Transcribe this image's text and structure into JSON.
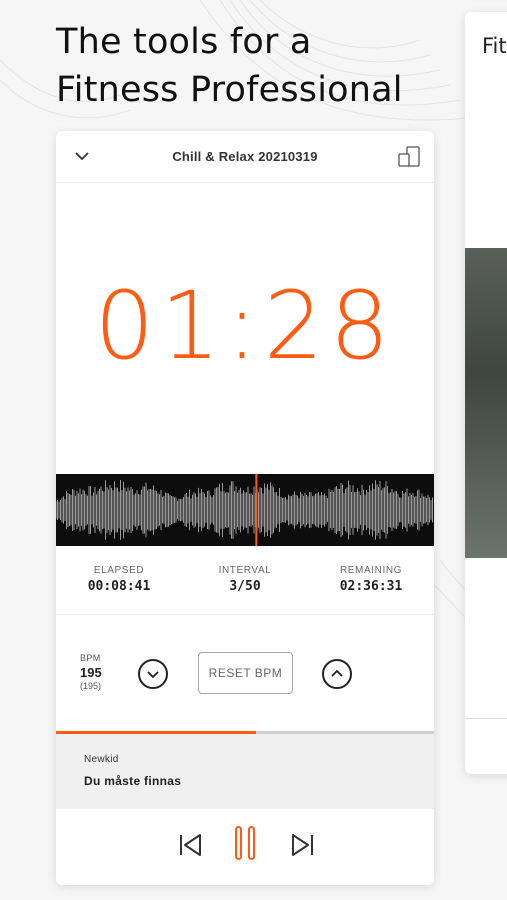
{
  "headline": {
    "line1": "The tools for a",
    "line2": "Fitness Professional"
  },
  "player": {
    "track_title": "Chill & Relax 20210319",
    "timer": "01:28",
    "stats": {
      "elapsed_label": "ELAPSED",
      "elapsed_value": "00:08:41",
      "interval_label": "INTERVAL",
      "interval_value": "3/50",
      "remaining_label": "REMAINING",
      "remaining_value": "02:36:31"
    },
    "bpm": {
      "label": "BPM",
      "value": "195",
      "original": "(195)"
    },
    "reset_label": "RESET BPM",
    "progress_fraction": 0.53,
    "waveform_position_fraction": 0.53,
    "now_playing": {
      "artist": "Newkid",
      "song": "Du måste finnas"
    }
  },
  "icons": {
    "collapse": "chevron-down-icon",
    "device": "devices-icon",
    "bpm_down": "chevron-down-circle-icon",
    "bpm_up": "chevron-up-circle-icon",
    "prev": "skip-previous-icon",
    "pause": "pause-icon",
    "next": "skip-next-icon"
  },
  "colors": {
    "accent": "#ff5b12",
    "waveform": "#9a9a9a",
    "waveform_bg": "#0d0d0d"
  },
  "side_card": {
    "title": "Fit"
  }
}
